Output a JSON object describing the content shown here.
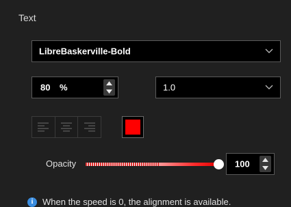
{
  "section": {
    "title": "Text"
  },
  "font": {
    "selected": "LibreBaskerville-Bold"
  },
  "size": {
    "value": "80",
    "unit": "%"
  },
  "line_height": {
    "selected": "1.0"
  },
  "alignment": {
    "options": [
      "left",
      "center",
      "right"
    ]
  },
  "color": {
    "value": "#ff0000"
  },
  "opacity": {
    "label": "Opacity",
    "value": "100",
    "fraction": 1.0
  },
  "info": {
    "icon": "info-icon",
    "glyph": "i",
    "text": "When the speed is 0, the alignment is available."
  }
}
